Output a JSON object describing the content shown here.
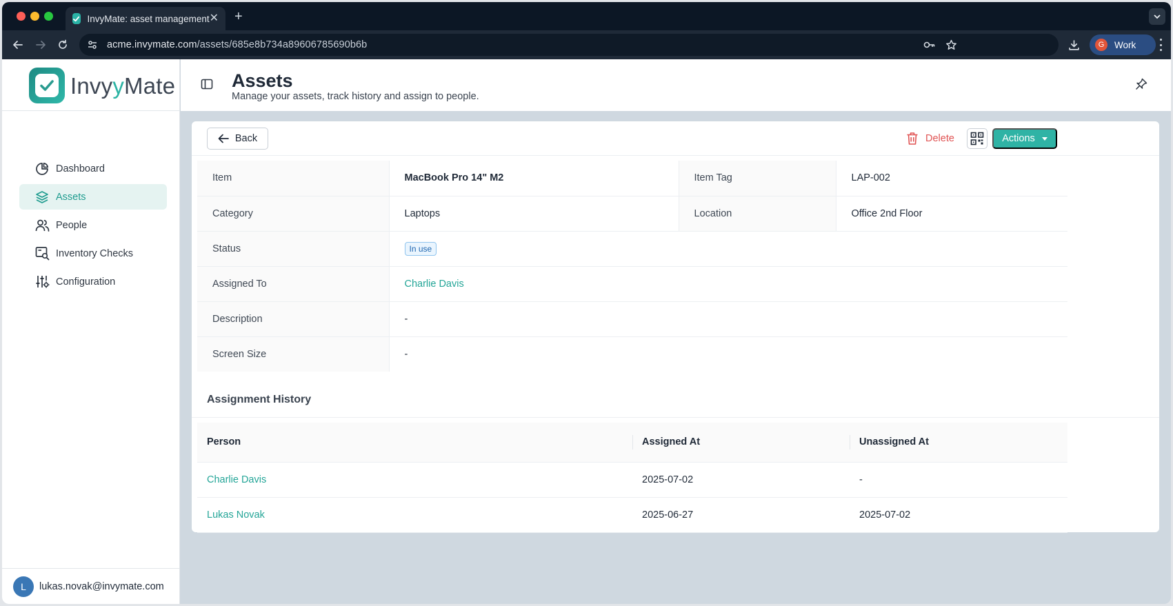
{
  "browser": {
    "tab_title": "InvyMate: asset management",
    "url_host": "acme.invymate.com",
    "url_path": "/assets/685e8b734a89606785690b6b",
    "profile_initial": "G",
    "profile_label": "Work"
  },
  "brand": {
    "name_part1": "Invy",
    "name_part2": "Mate",
    "accent_color": "#2fb3a5"
  },
  "sidebar": {
    "items": [
      {
        "label": "Dashboard",
        "icon": "pie-chart-icon",
        "active": false
      },
      {
        "label": "Assets",
        "icon": "layers-icon",
        "active": true
      },
      {
        "label": "People",
        "icon": "users-icon",
        "active": false
      },
      {
        "label": "Inventory Checks",
        "icon": "search-document-icon",
        "active": false
      },
      {
        "label": "Configuration",
        "icon": "sliders-icon",
        "active": false
      }
    ],
    "user": {
      "initial": "L",
      "email": "lukas.novak@invymate.com"
    }
  },
  "header": {
    "title": "Assets",
    "subtitle": "Manage your assets, track history and assign to people."
  },
  "toolbar": {
    "back_label": "Back",
    "delete_label": "Delete",
    "actions_label": "Actions"
  },
  "details": {
    "item_label": "Item",
    "item_value": "MacBook Pro 14\" M2",
    "tag_label": "Item Tag",
    "tag_value": "LAP-002",
    "category_label": "Category",
    "category_value": "Laptops",
    "location_label": "Location",
    "location_value": "Office 2nd Floor",
    "status_label": "Status",
    "status_value": "In use",
    "assigned_label": "Assigned To",
    "assigned_value": "Charlie Davis",
    "description_label": "Description",
    "description_value": "-",
    "screen_label": "Screen Size",
    "screen_value": "-"
  },
  "history": {
    "title": "Assignment History",
    "columns": [
      "Person",
      "Assigned At",
      "Unassigned At"
    ],
    "rows": [
      {
        "person": "Charlie Davis",
        "assigned_at": "2025-07-02",
        "unassigned_at": "-"
      },
      {
        "person": "Lukas Novak",
        "assigned_at": "2025-06-27",
        "unassigned_at": "2025-07-02"
      }
    ]
  }
}
